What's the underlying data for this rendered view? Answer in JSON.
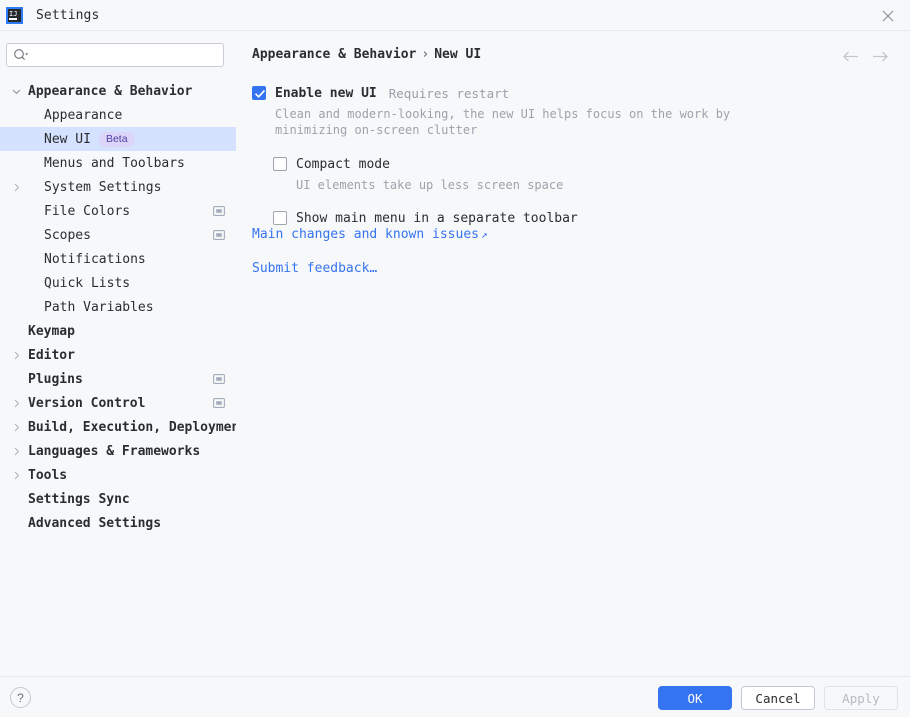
{
  "window": {
    "title": "Settings",
    "logo_text": "IJ",
    "close_icon": "close-icon"
  },
  "sidebar": {
    "search": {
      "placeholder": "",
      "value": "",
      "icon": "search-icon"
    },
    "items": [
      {
        "label": "Appearance & Behavior",
        "level": 0,
        "expander": "chevron-down",
        "selected": false,
        "badge": null,
        "project_icon": false
      },
      {
        "label": "Appearance",
        "level": 1,
        "expander": "none",
        "selected": false,
        "badge": null,
        "project_icon": false
      },
      {
        "label": "New UI",
        "level": 1,
        "expander": "none",
        "selected": true,
        "badge": "Beta",
        "project_icon": false
      },
      {
        "label": "Menus and Toolbars",
        "level": 1,
        "expander": "none",
        "selected": false,
        "badge": null,
        "project_icon": false
      },
      {
        "label": "System Settings",
        "level": 1,
        "expander": "chevron-right",
        "selected": false,
        "badge": null,
        "project_icon": false
      },
      {
        "label": "File Colors",
        "level": 1,
        "expander": "none",
        "selected": false,
        "badge": null,
        "project_icon": true
      },
      {
        "label": "Scopes",
        "level": 1,
        "expander": "none",
        "selected": false,
        "badge": null,
        "project_icon": true
      },
      {
        "label": "Notifications",
        "level": 1,
        "expander": "none",
        "selected": false,
        "badge": null,
        "project_icon": false
      },
      {
        "label": "Quick Lists",
        "level": 1,
        "expander": "none",
        "selected": false,
        "badge": null,
        "project_icon": false
      },
      {
        "label": "Path Variables",
        "level": 1,
        "expander": "none",
        "selected": false,
        "badge": null,
        "project_icon": false
      },
      {
        "label": "Keymap",
        "level": 0,
        "expander": "none",
        "selected": false,
        "badge": null,
        "project_icon": false
      },
      {
        "label": "Editor",
        "level": 0,
        "expander": "chevron-right",
        "selected": false,
        "badge": null,
        "project_icon": false
      },
      {
        "label": "Plugins",
        "level": 0,
        "expander": "none",
        "selected": false,
        "badge": null,
        "project_icon": true
      },
      {
        "label": "Version Control",
        "level": 0,
        "expander": "chevron-right",
        "selected": false,
        "badge": null,
        "project_icon": true
      },
      {
        "label": "Build, Execution, Deployment",
        "level": 0,
        "expander": "chevron-right",
        "selected": false,
        "badge": null,
        "project_icon": false
      },
      {
        "label": "Languages & Frameworks",
        "level": 0,
        "expander": "chevron-right",
        "selected": false,
        "badge": null,
        "project_icon": false
      },
      {
        "label": "Tools",
        "level": 0,
        "expander": "chevron-right",
        "selected": false,
        "badge": null,
        "project_icon": false
      },
      {
        "label": "Settings Sync",
        "level": 0,
        "expander": "none",
        "selected": false,
        "badge": null,
        "project_icon": false
      },
      {
        "label": "Advanced Settings",
        "level": 0,
        "expander": "none",
        "selected": false,
        "badge": null,
        "project_icon": false
      }
    ]
  },
  "content": {
    "breadcrumb": {
      "root": "Appearance & Behavior",
      "separator": "›",
      "leaf": "New UI"
    },
    "nav": {
      "back_icon": "arrow-left-icon",
      "forward_icon": "arrow-right-icon"
    },
    "options": {
      "enable_new_ui": {
        "label": "Enable new UI",
        "hint": "Requires restart",
        "checked": true,
        "description_line1": "Clean and modern-looking, the new UI helps focus on the work by",
        "description_line2": "minimizing on-screen clutter"
      },
      "compact_mode": {
        "label": "Compact mode",
        "checked": false,
        "description": "UI elements take up less screen space"
      },
      "separate_toolbar": {
        "label": "Show main menu in a separate toolbar",
        "checked": false
      }
    },
    "links": [
      {
        "text": "Main changes and known issues",
        "external": true,
        "external_glyph": "↗"
      },
      {
        "text": "Submit feedback…",
        "external": false,
        "external_glyph": ""
      }
    ]
  },
  "footer": {
    "help_label": "?",
    "ok_label": "OK",
    "cancel_label": "Cancel",
    "apply_label": "Apply",
    "apply_enabled": false
  },
  "colors": {
    "accent": "#3574f0",
    "selection": "#d4e2ff",
    "badge_bg": "#ddd5f7",
    "badge_fg": "#4f3fa8",
    "background": "#f7f8fa",
    "text": "#2b2d30",
    "muted": "#9ea2ab"
  }
}
